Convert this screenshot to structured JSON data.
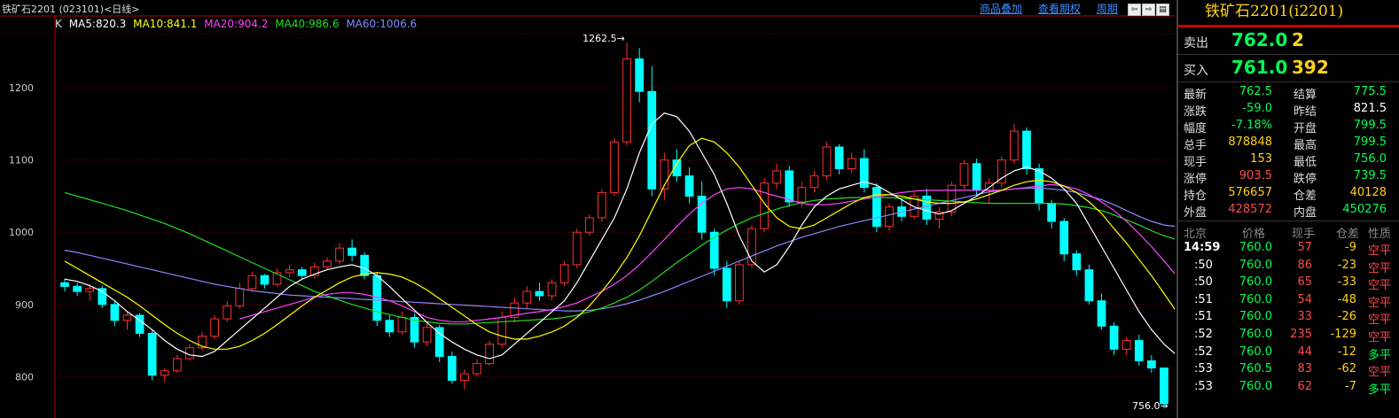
{
  "window": {
    "title": "铁矿石2201 (023101)<日线>",
    "links": [
      "商品叠加",
      "查看期权",
      "周期"
    ],
    "buttons": [
      "⇦",
      "⇨",
      "▤"
    ]
  },
  "indicators": {
    "k_label": "K",
    "items": [
      {
        "text": "MA5:820.3",
        "color": "#ffffff"
      },
      {
        "text": "MA10:841.1",
        "color": "#ffff00"
      },
      {
        "text": "MA20:904.2",
        "color": "#ff44ff"
      },
      {
        "text": "MA40:986.6",
        "color": "#22dd22"
      },
      {
        "text": "MA60:1006.6",
        "color": "#8888ff"
      }
    ]
  },
  "chart_data": {
    "type": "candlestick",
    "ylim": [
      755,
      1275
    ],
    "yticks": [
      800,
      900,
      1000,
      1100,
      1200
    ],
    "annotations": [
      {
        "text": "1262.5",
        "value": 1262.5,
        "index": 45
      },
      {
        "text": "756.0",
        "value": 756.0,
        "index": 88
      }
    ],
    "colors": {
      "up": "#ff3030",
      "down": "#00ffff",
      "ma5": "#ffffff",
      "ma10": "#ffff00",
      "ma20": "#ff44ff",
      "ma40": "#22dd22",
      "ma60": "#8888ff",
      "grid": "#7a0000"
    },
    "candles": [
      [
        930,
        936,
        918,
        925
      ],
      [
        925,
        930,
        912,
        918
      ],
      [
        918,
        928,
        905,
        922
      ],
      [
        922,
        926,
        895,
        900
      ],
      [
        900,
        904,
        870,
        878
      ],
      [
        878,
        890,
        865,
        885
      ],
      [
        885,
        888,
        855,
        860
      ],
      [
        860,
        865,
        795,
        802
      ],
      [
        802,
        812,
        792,
        808
      ],
      [
        808,
        830,
        805,
        825
      ],
      [
        825,
        845,
        822,
        840
      ],
      [
        840,
        862,
        836,
        856
      ],
      [
        856,
        885,
        852,
        880
      ],
      [
        880,
        905,
        876,
        898
      ],
      [
        898,
        930,
        894,
        922
      ],
      [
        922,
        945,
        918,
        940
      ],
      [
        940,
        942,
        922,
        928
      ],
      [
        928,
        950,
        925,
        944
      ],
      [
        944,
        955,
        938,
        948
      ],
      [
        948,
        952,
        935,
        940
      ],
      [
        940,
        958,
        936,
        952
      ],
      [
        952,
        965,
        948,
        960
      ],
      [
        960,
        985,
        955,
        978
      ],
      [
        978,
        990,
        960,
        968
      ],
      [
        968,
        972,
        935,
        940
      ],
      [
        940,
        945,
        870,
        878
      ],
      [
        878,
        885,
        855,
        862
      ],
      [
        862,
        890,
        858,
        882
      ],
      [
        882,
        888,
        840,
        848
      ],
      [
        848,
        875,
        842,
        868
      ],
      [
        868,
        872,
        820,
        828
      ],
      [
        828,
        835,
        790,
        795
      ],
      [
        795,
        810,
        782,
        804
      ],
      [
        804,
        824,
        800,
        818
      ],
      [
        818,
        850,
        815,
        845
      ],
      [
        845,
        890,
        840,
        882
      ],
      [
        882,
        910,
        875,
        902
      ],
      [
        902,
        925,
        894,
        918
      ],
      [
        918,
        930,
        905,
        912
      ],
      [
        912,
        935,
        906,
        930
      ],
      [
        930,
        960,
        925,
        955
      ],
      [
        955,
        1005,
        950,
        1000
      ],
      [
        1000,
        1025,
        995,
        1020
      ],
      [
        1020,
        1060,
        1015,
        1055
      ],
      [
        1055,
        1130,
        1050,
        1125
      ],
      [
        1125,
        1262.5,
        1120,
        1240
      ],
      [
        1240,
        1255,
        1180,
        1195
      ],
      [
        1195,
        1230,
        1050,
        1060
      ],
      [
        1060,
        1110,
        1045,
        1100
      ],
      [
        1100,
        1115,
        1070,
        1078
      ],
      [
        1078,
        1090,
        1040,
        1050
      ],
      [
        1050,
        1070,
        990,
        1000
      ],
      [
        1000,
        1005,
        940,
        950
      ],
      [
        950,
        960,
        895,
        905
      ],
      [
        905,
        960,
        900,
        955
      ],
      [
        955,
        1010,
        950,
        1005
      ],
      [
        1005,
        1075,
        1000,
        1068
      ],
      [
        1068,
        1095,
        1060,
        1085
      ],
      [
        1085,
        1092,
        1035,
        1042
      ],
      [
        1042,
        1070,
        1035,
        1062
      ],
      [
        1062,
        1085,
        1055,
        1078
      ],
      [
        1078,
        1125,
        1072,
        1118
      ],
      [
        1118,
        1122,
        1080,
        1088
      ],
      [
        1088,
        1110,
        1082,
        1102
      ],
      [
        1102,
        1115,
        1055,
        1062
      ],
      [
        1062,
        1068,
        1000,
        1008
      ],
      [
        1008,
        1040,
        1002,
        1035
      ],
      [
        1035,
        1045,
        1015,
        1022
      ],
      [
        1022,
        1055,
        1018,
        1050
      ],
      [
        1050,
        1060,
        1010,
        1018
      ],
      [
        1018,
        1035,
        1005,
        1028
      ],
      [
        1028,
        1070,
        1022,
        1065
      ],
      [
        1065,
        1100,
        1060,
        1095
      ],
      [
        1095,
        1102,
        1050,
        1058
      ],
      [
        1058,
        1075,
        1040,
        1068
      ],
      [
        1068,
        1105,
        1062,
        1100
      ],
      [
        1100,
        1150,
        1095,
        1140
      ],
      [
        1140,
        1145,
        1080,
        1088
      ],
      [
        1088,
        1095,
        1030,
        1040
      ],
      [
        1040,
        1045,
        1005,
        1015
      ],
      [
        1015,
        1020,
        960,
        970
      ],
      [
        970,
        975,
        940,
        948
      ],
      [
        948,
        955,
        900,
        905
      ],
      [
        905,
        915,
        865,
        870
      ],
      [
        870,
        875,
        830,
        838
      ],
      [
        838,
        855,
        830,
        850
      ],
      [
        850,
        858,
        815,
        822
      ],
      [
        822,
        830,
        805,
        812
      ],
      [
        812,
        812,
        756,
        762.5
      ]
    ],
    "ma5": [
      935,
      932,
      926,
      918,
      905,
      890,
      878,
      865,
      850,
      838,
      830,
      828,
      835,
      850,
      865,
      880,
      895,
      910,
      925,
      935,
      942,
      948,
      952,
      955,
      950,
      940,
      925,
      908,
      892,
      875,
      860,
      848,
      838,
      830,
      825,
      830,
      845,
      860,
      875,
      890,
      905,
      930,
      960,
      990,
      1020,
      1060,
      1110,
      1150,
      1165,
      1160,
      1140,
      1110,
      1080,
      1040,
      995,
      960,
      945,
      955,
      980,
      1010,
      1035,
      1050,
      1060,
      1065,
      1070,
      1065,
      1055,
      1045,
      1035,
      1030,
      1025,
      1030,
      1040,
      1050,
      1062,
      1075,
      1085,
      1090,
      1085,
      1075,
      1060,
      1040,
      1010,
      980,
      950,
      920,
      890,
      865,
      845,
      830,
      820.3
    ],
    "ma10": [
      960,
      950,
      940,
      930,
      920,
      910,
      898,
      885,
      872,
      860,
      850,
      842,
      838,
      838,
      842,
      850,
      860,
      872,
      885,
      898,
      910,
      920,
      930,
      938,
      942,
      944,
      942,
      938,
      930,
      920,
      908,
      896,
      884,
      872,
      862,
      856,
      852,
      852,
      856,
      862,
      870,
      882,
      898,
      918,
      940,
      965,
      995,
      1030,
      1065,
      1095,
      1120,
      1130,
      1125,
      1110,
      1090,
      1065,
      1040,
      1020,
      1008,
      1005,
      1010,
      1020,
      1030,
      1040,
      1048,
      1052,
      1052,
      1050,
      1046,
      1042,
      1040,
      1040,
      1042,
      1046,
      1052,
      1058,
      1065,
      1070,
      1072,
      1070,
      1064,
      1055,
      1042,
      1026,
      1005,
      985,
      962,
      940,
      915,
      890,
      865,
      850,
      841.1
    ],
    "ma20": [
      null,
      null,
      null,
      null,
      null,
      null,
      null,
      null,
      null,
      null,
      null,
      null,
      null,
      null,
      880,
      885,
      890,
      895,
      900,
      905,
      910,
      914,
      916,
      916,
      914,
      910,
      905,
      898,
      890,
      882,
      878,
      876,
      876,
      878,
      880,
      882,
      885,
      888,
      890,
      893,
      897,
      902,
      910,
      918,
      928,
      940,
      955,
      972,
      990,
      1008,
      1025,
      1040,
      1052,
      1060,
      1062,
      1060,
      1055,
      1050,
      1045,
      1040,
      1038,
      1038,
      1040,
      1043,
      1046,
      1049,
      1052,
      1055,
      1057,
      1058,
      1058,
      1058,
      1058,
      1058,
      1058,
      1058,
      1060,
      1062,
      1064,
      1066,
      1064,
      1060,
      1052,
      1042,
      1030,
      1015,
      998,
      980,
      960,
      940,
      904.2
    ],
    "ma40": [
      1055,
      1050,
      1045,
      1040,
      1035,
      1030,
      1024,
      1018,
      1012,
      1005,
      998,
      990,
      982,
      974,
      966,
      958,
      950,
      942,
      934,
      926,
      918,
      912,
      906,
      900,
      895,
      890,
      886,
      882,
      878,
      876,
      874,
      873,
      873,
      874,
      875,
      876,
      877,
      878,
      879,
      880,
      882,
      885,
      890,
      895,
      902,
      910,
      920,
      932,
      945,
      958,
      970,
      982,
      993,
      1003,
      1012,
      1020,
      1026,
      1032,
      1037,
      1041,
      1044,
      1046,
      1047,
      1048,
      1048,
      1048,
      1048,
      1047,
      1046,
      1045,
      1044,
      1043,
      1042,
      1041,
      1040,
      1040,
      1040,
      1040,
      1040,
      1040,
      1039,
      1037,
      1034,
      1030,
      1024,
      1017,
      1010,
      1002,
      995,
      990,
      986.6
    ],
    "ma60": [
      975,
      972,
      968,
      964,
      960,
      956,
      952,
      948,
      944,
      940,
      936,
      932,
      928,
      925,
      922,
      919,
      917,
      915,
      913,
      912,
      911,
      910,
      909,
      908,
      907,
      906,
      905,
      904,
      903,
      902,
      901,
      900,
      899,
      898,
      897,
      896,
      895,
      894,
      893,
      892,
      891,
      891,
      892,
      894,
      897,
      901,
      906,
      912,
      918,
      925,
      932,
      939,
      946,
      953,
      960,
      967,
      974,
      981,
      987,
      993,
      998,
      1003,
      1008,
      1012,
      1016,
      1020,
      1024,
      1028,
      1032,
      1036,
      1040,
      1044,
      1048,
      1052,
      1056,
      1058,
      1060,
      1061,
      1061,
      1060,
      1058,
      1055,
      1050,
      1045,
      1038,
      1030,
      1022,
      1015,
      1010,
      1008,
      1006.6
    ]
  },
  "panel": {
    "title": "铁矿石2201(i2201)",
    "ask": {
      "label": "卖出",
      "price": "762.0",
      "vol": "2"
    },
    "bid": {
      "label": "买入",
      "price": "761.0",
      "vol": "392"
    },
    "stats": [
      {
        "l1": "最新",
        "v1": "762.5",
        "c1": "g",
        "l2": "结算",
        "v2": "775.5",
        "c2": "g"
      },
      {
        "l1": "涨跌",
        "v1": "-59.0",
        "c1": "g",
        "l2": "昨结",
        "v2": "821.5",
        "c2": "w"
      },
      {
        "l1": "幅度",
        "v1": "-7.18%",
        "c1": "g",
        "l2": "开盘",
        "v2": "799.5",
        "c2": "g"
      },
      {
        "l1": "总手",
        "v1": "878848",
        "c1": "y",
        "l2": "最高",
        "v2": "799.5",
        "c2": "g"
      },
      {
        "l1": "现手",
        "v1": "153",
        "c1": "y",
        "l2": "最低",
        "v2": "756.0",
        "c2": "g"
      },
      {
        "l1": "涨停",
        "v1": "903.5",
        "c1": "r",
        "l2": "跌停",
        "v2": "739.5",
        "c2": "g"
      },
      {
        "l1": "持仓",
        "v1": "576657",
        "c1": "y",
        "l2": "仓差",
        "v2": "40128",
        "c2": "y"
      },
      {
        "l1": "外盘",
        "v1": "428572",
        "c1": "r",
        "l2": "内盘",
        "v2": "450276",
        "c2": "g"
      }
    ],
    "trades_header": [
      "北京",
      "价格",
      "现手",
      "仓差",
      "性质"
    ],
    "trades": [
      {
        "time": "14:59",
        "price": "760.0",
        "vol": "57",
        "diff": "-9",
        "nature": "空平",
        "nc": "r"
      },
      {
        "time": ":50",
        "price": "760.0",
        "vol": "86",
        "diff": "-23",
        "nature": "空平",
        "nc": "r"
      },
      {
        "time": ":50",
        "price": "760.0",
        "vol": "65",
        "diff": "-33",
        "nature": "空平",
        "nc": "r"
      },
      {
        "time": ":51",
        "price": "760.0",
        "vol": "54",
        "diff": "-48",
        "nature": "空平",
        "nc": "r"
      },
      {
        "time": ":51",
        "price": "760.0",
        "vol": "33",
        "diff": "-26",
        "nature": "空平",
        "nc": "r"
      },
      {
        "time": ":52",
        "price": "760.0",
        "vol": "235",
        "diff": "-129",
        "nature": "空平",
        "nc": "r"
      },
      {
        "time": ":52",
        "price": "760.0",
        "vol": "44",
        "diff": "-12",
        "nature": "多平",
        "nc": "g"
      },
      {
        "time": ":53",
        "price": "760.5",
        "vol": "83",
        "diff": "-62",
        "nature": "空平",
        "nc": "r"
      },
      {
        "time": ":53",
        "price": "760.0",
        "vol": "62",
        "diff": "-7",
        "nature": "多平",
        "nc": "g"
      }
    ]
  }
}
